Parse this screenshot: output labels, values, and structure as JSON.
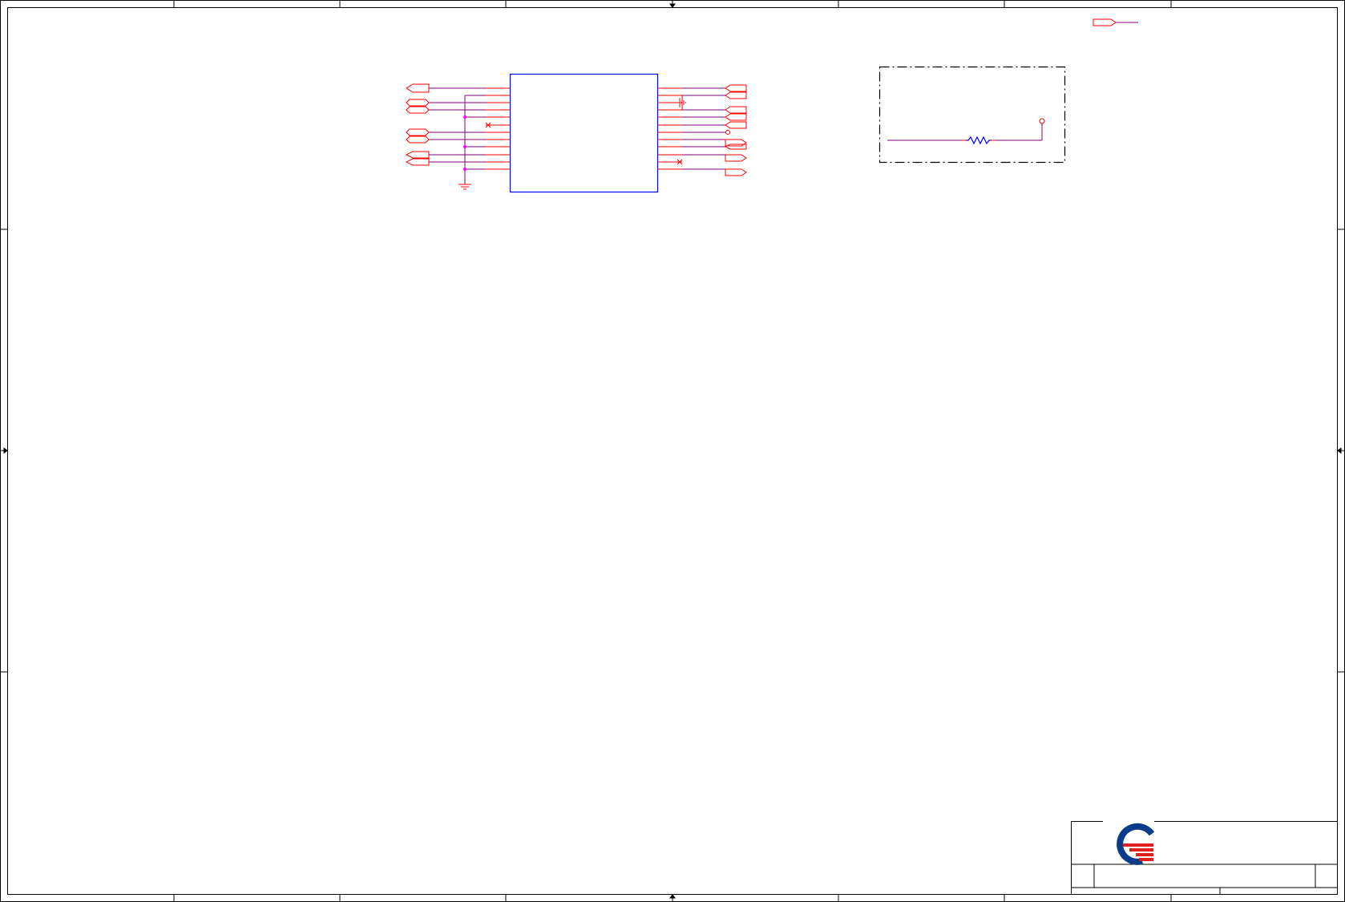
{
  "sheet": {
    "border_color": "#000000",
    "frame_zones_columns": 8,
    "frame_zones_rows": 4,
    "background": "#ffffff"
  },
  "schematic": {
    "component_outline_color": "#0000ff",
    "pin_color": "#ff0000",
    "wire_color": "#800080",
    "junction_color": "#ff00ff",
    "left_pins": 12,
    "right_pins": 12,
    "left_port_count": 7,
    "right_port_count": 9,
    "ground_symbol": "ground-icon",
    "no_connect_marks": 2,
    "power_capacitor_symbol": "capacitor-icon"
  },
  "subcircuit": {
    "border_style": "dash-dot",
    "resistor_symbol": "resistor-icon",
    "test_point_symbol": "test-point-icon"
  },
  "offpage_connector": {
    "symbol": "offpage-port-icon"
  },
  "title_block": {
    "logo_icon": "company-logo-icon",
    "logo_colors": [
      "#0a3c8c",
      "#e02020"
    ],
    "fields_empty": true
  }
}
